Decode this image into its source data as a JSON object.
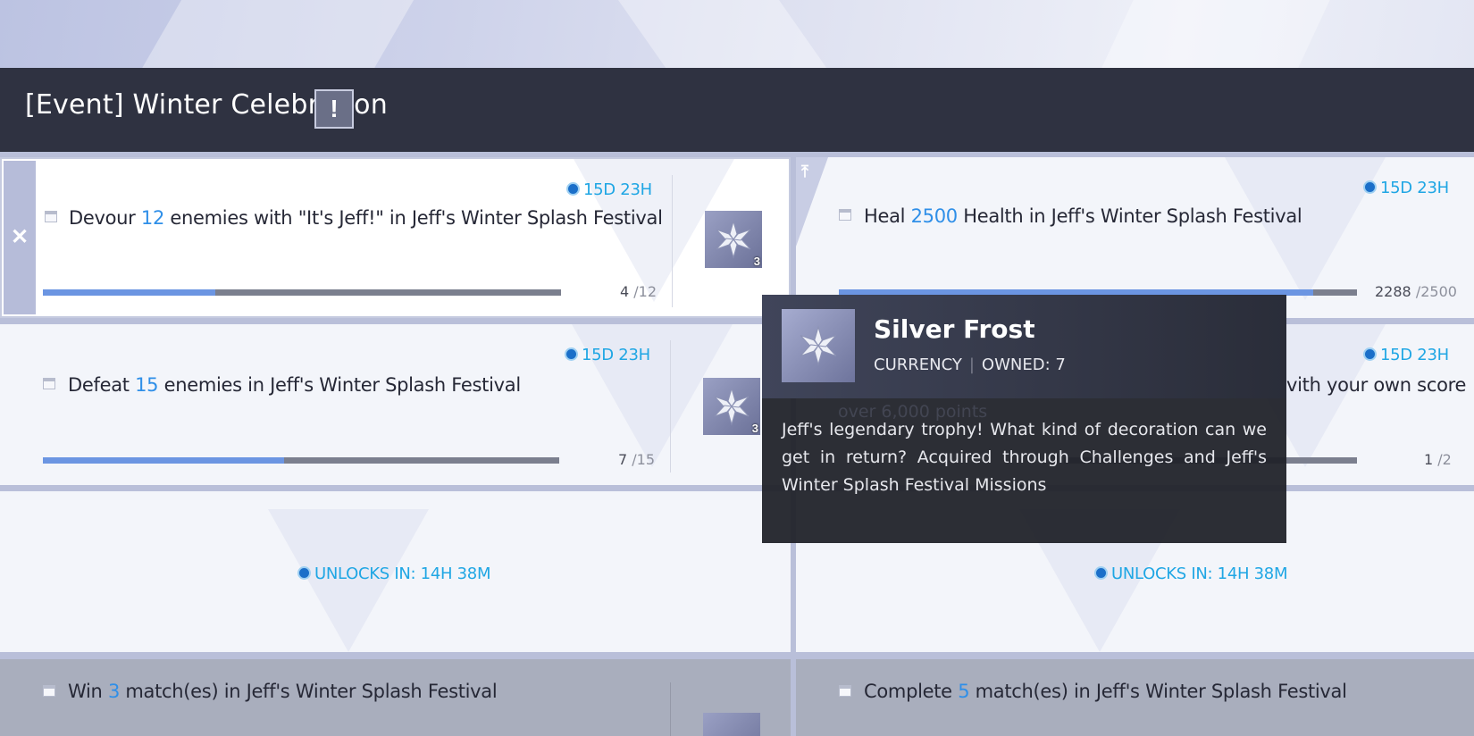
{
  "header": {
    "title": "[Event] Winter Celebration",
    "alert_symbol": "!"
  },
  "missions": [
    {
      "timer": "15D 23H",
      "text_pre": "Devour ",
      "num": "12",
      "text_post": " enemies with \"It's Jeff!\" in Jeff's Winter Splash Festival",
      "progress_value": 4,
      "progress_total": "/12",
      "progress_fraction": 0.333,
      "reward_qty": "3",
      "side_action": "✕"
    },
    {
      "timer": "15D 23H",
      "text_pre": "Heal ",
      "num": "2500",
      "text_post": " Health in Jeff's Winter Splash Festival",
      "progress_value": 2288,
      "progress_total": "/2500",
      "progress_fraction": 0.915,
      "side_action": "⤒"
    },
    {
      "timer": "15D 23H",
      "text_pre": "Defeat ",
      "num": "15",
      "text_post": " enemies in Jeff's Winter Splash Festival",
      "progress_value": 7,
      "progress_total": "/15",
      "progress_fraction": 0.467,
      "reward_qty": "3"
    },
    {
      "timer": "15D 23H",
      "partial_line1": "vith your own score",
      "partial_line2": "over 6,000 points",
      "progress_value": 1,
      "progress_total": "/2"
    },
    {
      "unlock": "UNLOCKS IN: 14H 38M"
    },
    {
      "unlock": "UNLOCKS IN: 14H 38M"
    },
    {
      "text_pre": "Win ",
      "num": "3",
      "text_post": " match(es) in Jeff's Winter Splash Festival"
    },
    {
      "text_pre": "Complete ",
      "num": "5",
      "text_post": " match(es) in Jeff's Winter Splash Festival"
    }
  ],
  "tooltip": {
    "name": "Silver Frost",
    "type": "CURRENCY",
    "owned": "OWNED: 7",
    "description": "Jeff's legendary trophy! What kind of decoration can we get in return? Acquired through Challenges and Jeff's Winter Splash Festival Missions",
    "icon": "silver-frost-snowflake-icon"
  },
  "colors": {
    "header_bg": "#2f3241",
    "accent_number": "#2f8fe8",
    "timer": "#1fa6e4",
    "progress_fill": "#6b95e2",
    "tooltip_bg": "#21232a"
  }
}
